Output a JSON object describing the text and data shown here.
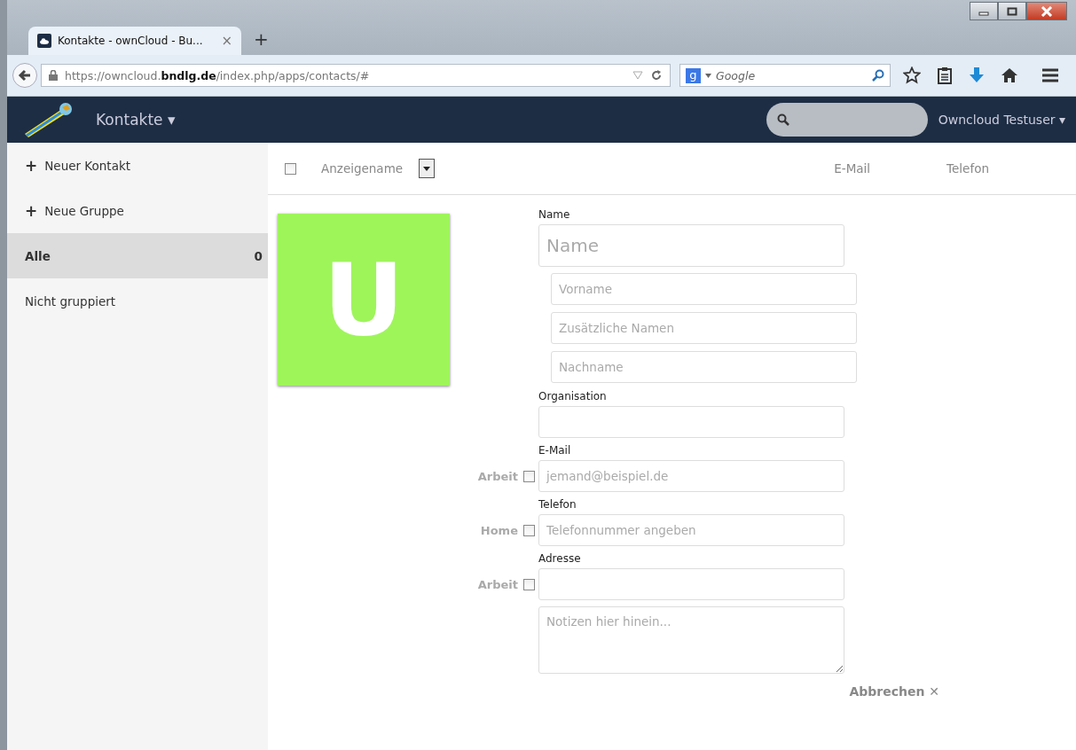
{
  "browser": {
    "tab": {
      "title": "Kontakte - ownCloud - Bu...",
      "close": "×"
    },
    "new_tab": "+",
    "url": "https://owncloud.**bndlg.de**/index.php/apps/contacts/#",
    "search": {
      "engine": "g",
      "placeholder": "Google"
    }
  },
  "header": {
    "app": "Kontakte",
    "caret": "▾",
    "user": "Owncloud Testuser",
    "user_caret": "▾"
  },
  "sidebar": {
    "actions": [
      {
        "icon": "+",
        "label": "Neuer Kontakt"
      },
      {
        "icon": "+",
        "label": "Neue Gruppe"
      }
    ],
    "groups": [
      {
        "label": "Alle",
        "count": "0",
        "selected": true
      },
      {
        "label": "Nicht gruppiert",
        "selected": false
      }
    ]
  },
  "list_header": {
    "select_all": {
      "checked": false
    },
    "columns": [
      "Anzeigename",
      "E-Mail",
      "Telefon"
    ]
  },
  "contact": {
    "avatar": {
      "letter": "U",
      "color": "#9ef55a"
    },
    "name_label": "Name",
    "name_placeholder": "Name",
    "name_parts": [
      {
        "placeholder": "Vorname"
      },
      {
        "placeholder": "Zusätzliche Namen"
      },
      {
        "placeholder": "Nachname"
      }
    ],
    "org_label": "Organisation",
    "fields": [
      {
        "label": "E-Mail",
        "type": "Arbeit",
        "checked": false,
        "placeholder": "jemand@beispiel.de"
      },
      {
        "label": "Telefon",
        "type": "Home",
        "checked": false,
        "placeholder": "Telefonnummer angeben"
      },
      {
        "label": "Adresse",
        "type": "Arbeit",
        "checked": false
      }
    ],
    "notes_placeholder": "Notizen hier hinein...",
    "cancel": "Abbrechen",
    "cancel_icon": "✕"
  }
}
